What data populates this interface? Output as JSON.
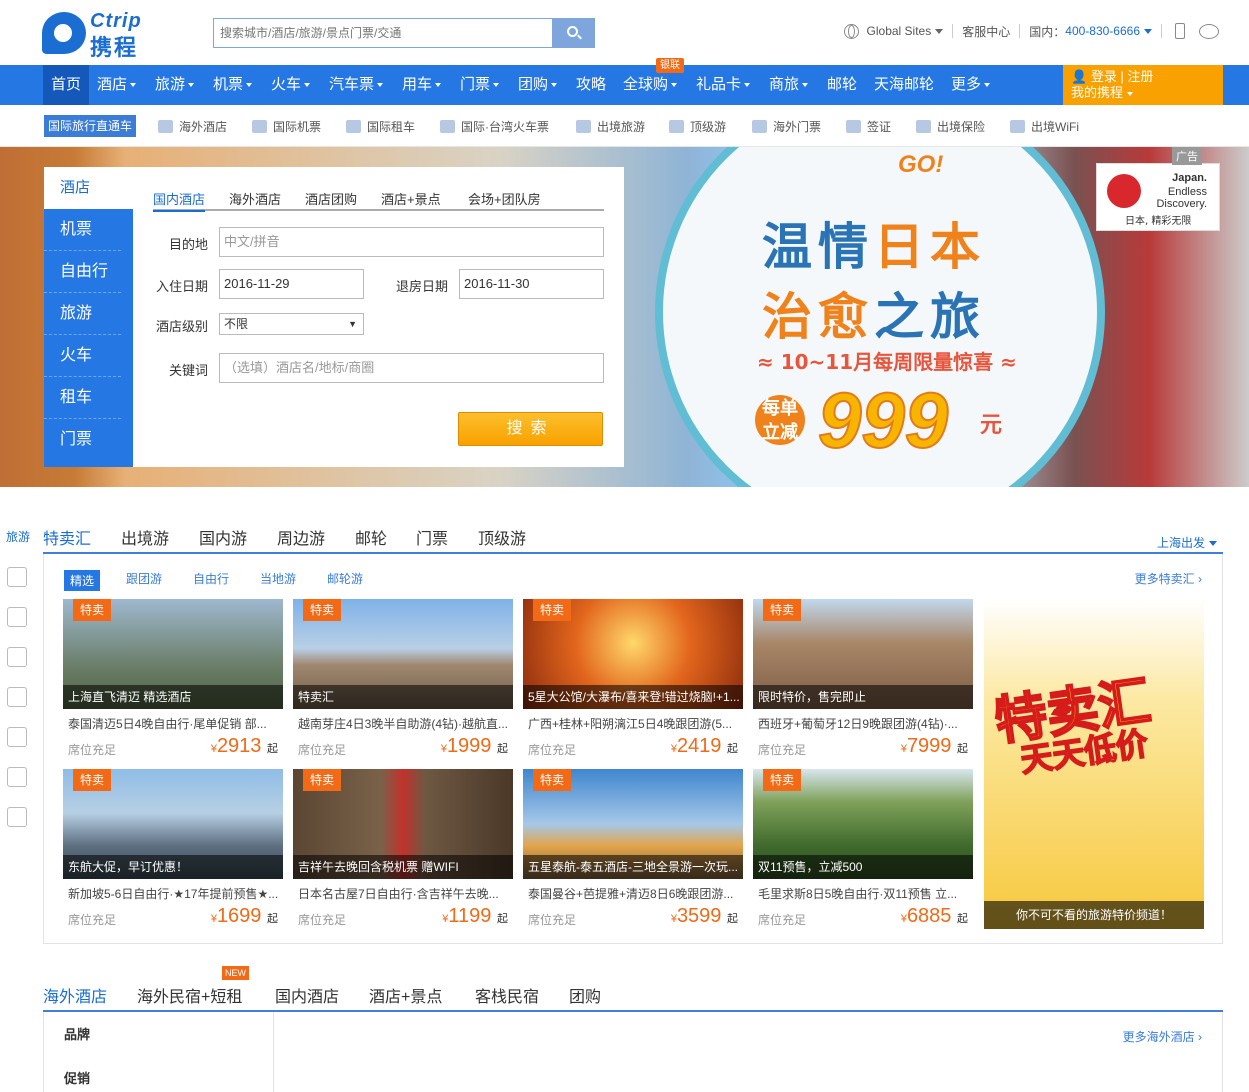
{
  "header": {
    "logo_en": "Ctrip",
    "logo_cn": "携程",
    "search_placeholder": "搜索城市/酒店/旅游/景点门票/交通",
    "global_sites": "Global Sites",
    "service": "客服中心",
    "domestic_label": "国内：",
    "phone": "400-830-6666"
  },
  "nav": {
    "items": [
      "首页",
      "酒店",
      "旅游",
      "机票",
      "火车",
      "汽车票",
      "用车",
      "门票",
      "团购",
      "攻略",
      "全球购",
      "礼品卡",
      "商旅",
      "邮轮",
      "天海邮轮",
      "更多"
    ],
    "badge": "银联",
    "login": "登录 | 注册",
    "my": "我的携程"
  },
  "subnav": {
    "tag": "国际旅行直通车",
    "items": [
      "海外酒店",
      "国际机票",
      "国际租车",
      "国际·台湾火车票",
      "出境旅游",
      "顶级游",
      "海外门票",
      "签证",
      "出境保险",
      "出境WiFi"
    ]
  },
  "banner": {
    "go": "GO!",
    "title1a": "温情",
    "title1b": "日本",
    "title2a": "治愈",
    "title2b": "之旅",
    "subtitle": "≈ 10~11月每周限量惊喜 ≈",
    "pr_small": "每单立减",
    "pr_num": "999",
    "pr_unit": "元",
    "jp1": "Japan.",
    "jp2": "Endless",
    "jp3": "Discovery.",
    "jp4": "日本, 精彩无限",
    "ad": "广告"
  },
  "booking": {
    "side": [
      "酒店",
      "机票",
      "自由行",
      "旅游",
      "火车",
      "租车",
      "门票"
    ],
    "tabs": [
      "国内酒店",
      "海外酒店",
      "酒店团购",
      "酒店+景点",
      "会场+团队房"
    ],
    "dest_label": "目的地",
    "dest_ph": "中文/拼音",
    "in_label": "入住日期",
    "in_val": "2016-11-29",
    "out_label": "退房日期",
    "out_val": "2016-11-30",
    "level_label": "酒店级别",
    "level_val": "不限",
    "kw_label": "关键词",
    "kw_ph": "（选填）酒店名/地标/商圈",
    "search": "搜索"
  },
  "rail": {
    "label": "旅游"
  },
  "sec1": {
    "tabs": [
      "特卖汇",
      "出境游",
      "国内游",
      "周边游",
      "邮轮",
      "门票",
      "顶级游"
    ],
    "depart": "上海出发",
    "filters": [
      "精选",
      "跟团游",
      "自由行",
      "当地游",
      "邮轮游"
    ],
    "more": "更多特卖汇",
    "cards": [
      {
        "tag": "特卖",
        "cap": "上海直飞清迈 精选酒店",
        "desc": "泰国清迈5日4晚自由行·尾单促销 部...",
        "seat": "席位充足",
        "price": "2913"
      },
      {
        "tag": "特卖",
        "cap": "特卖汇",
        "desc": "越南芽庄4日3晚半自助游(4钻)·越航直...",
        "seat": "席位充足",
        "price": "1999"
      },
      {
        "tag": "特卖",
        "cap": "5星大公馆/大瀑布/喜来登!错过烧脑!+1...",
        "desc": "广西+桂林+阳朔漓江5日4晚跟团游(5...",
        "seat": "席位充足",
        "price": "2419"
      },
      {
        "tag": "特卖",
        "cap": "限时特价，售完即止",
        "desc": "西班牙+葡萄牙12日9晚跟团游(4钻)·...",
        "seat": "席位充足",
        "price": "7999"
      },
      {
        "tag": "特卖",
        "cap": "东航大促，早订优惠！",
        "desc": "新加坡5-6日自由行·★17年提前预售★...",
        "seat": "席位充足",
        "price": "1699"
      },
      {
        "tag": "特卖",
        "cap": "吉祥午去晚回含税机票 赠WIFI",
        "desc": "日本名古屋7日自由行·含吉祥午去晚...",
        "seat": "席位充足",
        "price": "1199"
      },
      {
        "tag": "特卖",
        "cap": "五星泰航-泰五酒店-三地全景游一次玩...",
        "desc": "泰国曼谷+芭提雅+清迈8日6晚跟团游...",
        "seat": "席位充足",
        "price": "3599"
      },
      {
        "tag": "特卖",
        "cap": "双11预售，立减500",
        "desc": "毛里求斯8日5晚自由行·双11预售 立...",
        "seat": "席位充足",
        "price": "6885"
      }
    ],
    "promo_big": "特卖汇",
    "promo_big2": "天天低价",
    "promo_foot": "你不可不看的旅游特价频道！",
    "yuan": "¥",
    "qi": "起"
  },
  "sec2": {
    "tabs": [
      "海外酒店",
      "海外民宿+短租",
      "国内酒店",
      "酒店+景点",
      "客栈民宿",
      "团购"
    ],
    "new": "NEW",
    "brand": "品牌",
    "promo": "促销",
    "more": "更多海外酒店"
  }
}
